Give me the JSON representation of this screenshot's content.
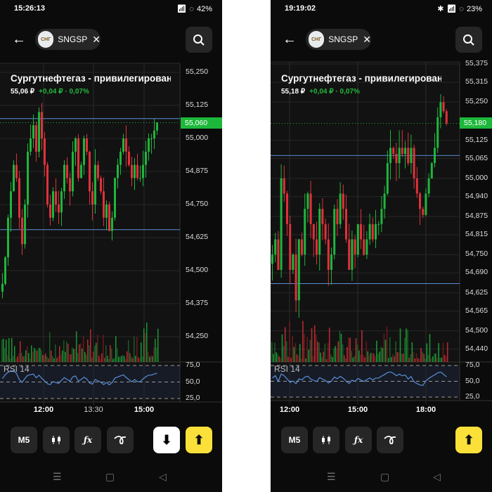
{
  "phones": [
    {
      "status": {
        "time": "15:26:13",
        "icons": "wifi signal",
        "battery": "42%"
      },
      "ticker": {
        "logo_text": "СНГ",
        "symbol": "SNGSP"
      },
      "title": "Сургутнефтегаз - привилегированн",
      "price": "55,06 ₽",
      "change": "+0,04 ₽ · 0,07%",
      "current_price_label": "55,060",
      "toolbar": {
        "timeframe": "M5",
        "candles_icon": "candlestick-icon",
        "fx_label": "ƒx",
        "draw_icon": "drawing-icon",
        "sell_label": "⬇",
        "buy_label": "⬆"
      },
      "nav": {
        "menu": "☰",
        "home": "▢",
        "back": "◁"
      },
      "chart_data": {
        "type": "candlestick",
        "y_ticks": [
          "55,250",
          "55,125",
          "55,000",
          "54,875",
          "54,750",
          "54,625",
          "54,500",
          "54,375",
          "54,250"
        ],
        "y_tick_values": [
          55.25,
          55.125,
          55.0,
          54.875,
          54.75,
          54.625,
          54.5,
          54.375,
          54.25
        ],
        "x_ticks": [
          "12:00",
          "13:30",
          "15:00"
        ],
        "current": 55.06,
        "levels": [
          55.075,
          54.655
        ],
        "closes": [
          54.45,
          54.55,
          54.7,
          54.8,
          54.9,
          54.85,
          54.7,
          54.6,
          54.75,
          54.95,
          55.0,
          55.05,
          54.95,
          55.1,
          55.0,
          54.9,
          54.75,
          54.7,
          54.8,
          54.75,
          54.72,
          54.8,
          54.9,
          54.85,
          54.8,
          54.95,
          55.0,
          54.85,
          54.9,
          55.0,
          54.95,
          54.8,
          54.75,
          54.9,
          54.85,
          54.8,
          54.7,
          54.75,
          54.65,
          54.7,
          54.85,
          54.9,
          54.95,
          55.0,
          54.95,
          54.9,
          54.85,
          54.9,
          54.85,
          54.85,
          54.9,
          54.95,
          55.0,
          55.0,
          55.03,
          55.06
        ],
        "rsi": {
          "label": "RSI 14",
          "ticks": [
            "75,0",
            "50,0",
            "25,0"
          ]
        }
      }
    },
    {
      "status": {
        "time": "19:19:02",
        "icons": "bluetooth wifi signal",
        "battery": "23%"
      },
      "ticker": {
        "logo_text": "СНГ",
        "symbol": "SNGSP"
      },
      "title": "Сургутнефтегаз - привилегированн",
      "price": "55,18 ₽",
      "change": "+0,04 ₽ · 0,07%",
      "current_price_label": "55,180",
      "toolbar": {
        "timeframe": "M5",
        "candles_icon": "candlestick-icon",
        "fx_label": "ƒx",
        "draw_icon": "drawing-icon",
        "buy_label": "⬆"
      },
      "nav": {
        "menu": "☰",
        "home": "▢",
        "back": "◁"
      },
      "chart_data": {
        "type": "candlestick",
        "y_ticks": [
          "55,375",
          "55,315",
          "55,250",
          "55,125",
          "55,065",
          "55,000",
          "54,940",
          "54,875",
          "54,815",
          "54,750",
          "54,690",
          "54,625",
          "54,565",
          "54,500",
          "54,440"
        ],
        "y_tick_values": [
          55.375,
          55.315,
          55.25,
          55.125,
          55.065,
          55.0,
          54.94,
          54.875,
          54.815,
          54.75,
          54.69,
          54.625,
          54.565,
          54.5,
          54.44
        ],
        "x_ticks": [
          "12:00",
          "15:00",
          "18:00"
        ],
        "current": 55.18,
        "levels": [
          55.075,
          54.655
        ],
        "closes": [
          54.75,
          54.8,
          54.7,
          55.0,
          54.95,
          54.85,
          54.7,
          54.75,
          54.6,
          54.8,
          54.75,
          54.9,
          54.95,
          54.85,
          54.8,
          54.75,
          54.9,
          54.85,
          54.8,
          54.7,
          54.75,
          54.9,
          54.85,
          54.95,
          54.9,
          54.8,
          54.7,
          54.8,
          54.75,
          54.85,
          54.8,
          54.75,
          54.8,
          54.85,
          54.8,
          54.85,
          54.85,
          54.9,
          54.95,
          55.05,
          55.1,
          55.08,
          55.05,
          55.1,
          55.08,
          55.1,
          55.05,
          55.1,
          55.0,
          54.95,
          54.9,
          54.88,
          54.95,
          55.0,
          55.05,
          55.1,
          55.2,
          55.25,
          55.22,
          55.18
        ],
        "rsi": {
          "label": "RSI 14",
          "ticks": [
            "75,0",
            "50,0",
            "25,0"
          ]
        }
      }
    }
  ]
}
